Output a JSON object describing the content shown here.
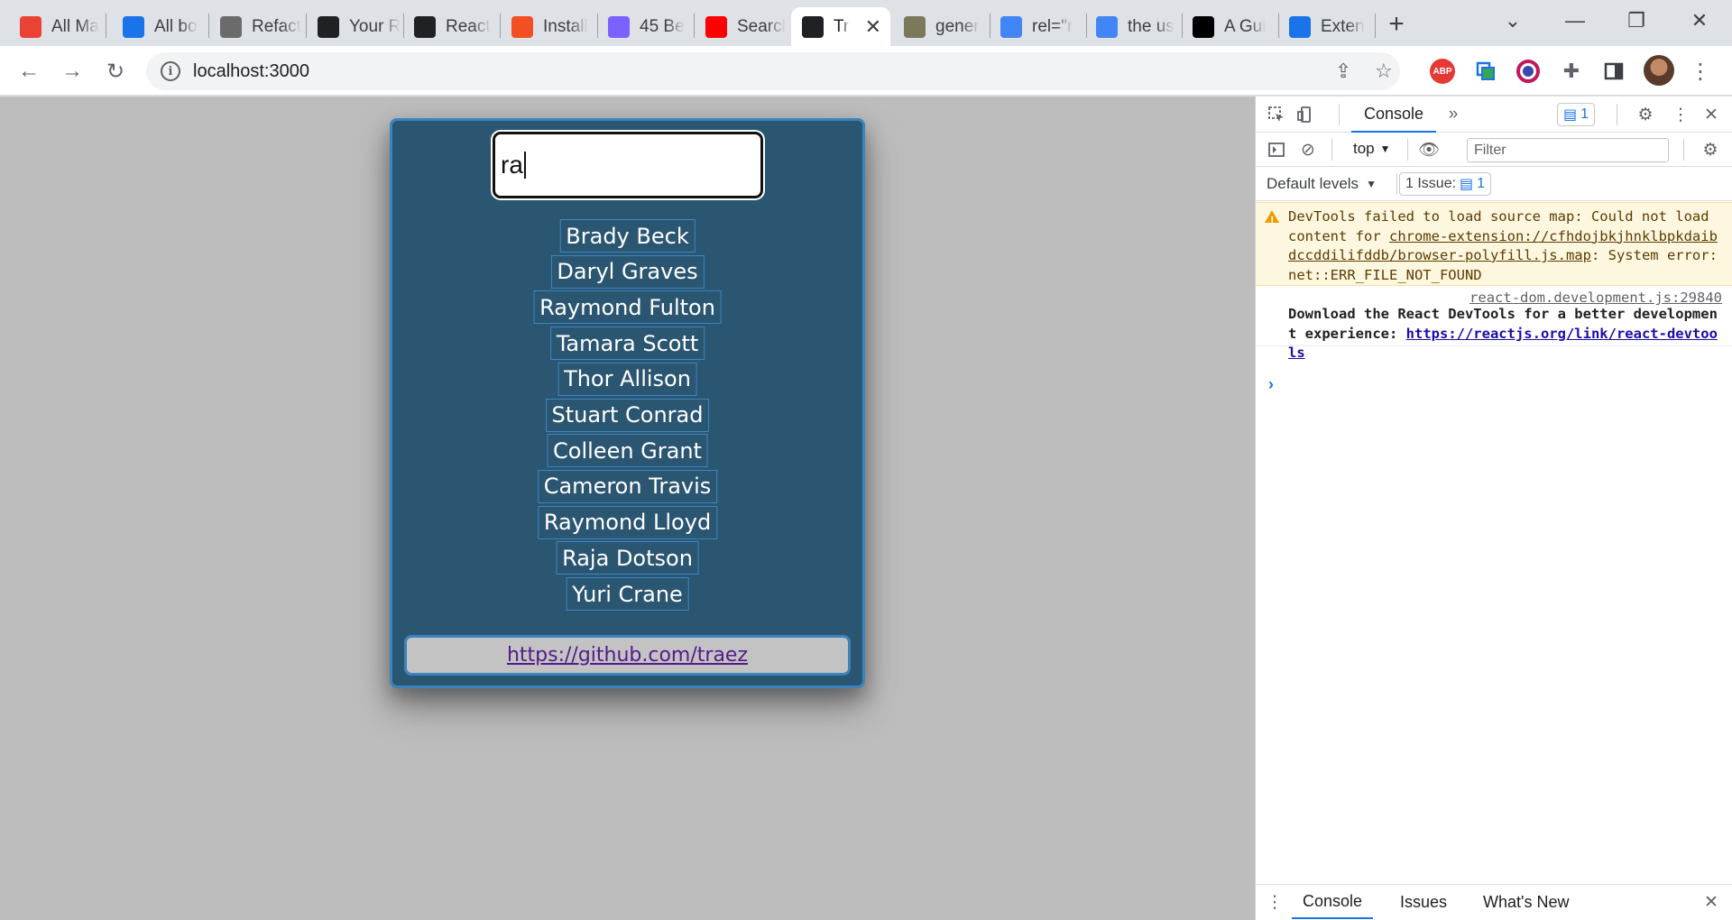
{
  "browser": {
    "tabs": [
      {
        "title": "All Ma",
        "icon": "gmail-icon",
        "color": "#ea4335"
      },
      {
        "title": "All bo",
        "icon": "cloud-icon",
        "color": "#1a73e8"
      },
      {
        "title": "Refact",
        "icon": "chatgpt-icon",
        "color": "#6b6b6b"
      },
      {
        "title": "Your R",
        "icon": "github-icon",
        "color": "#202124"
      },
      {
        "title": "React",
        "icon": "notion-icon",
        "color": "#202124"
      },
      {
        "title": "Install",
        "icon": "microsoft-icon",
        "color": "#f25022"
      },
      {
        "title": "45 Be",
        "icon": "c-letter-icon",
        "color": "#7b61ff"
      },
      {
        "title": "Searcl",
        "icon": "youtube-icon",
        "color": "#ff0000"
      },
      {
        "title": "Tr",
        "icon": "react-icon",
        "color": "#202124",
        "active": true
      },
      {
        "title": "gener",
        "icon": "pixel-pattern-icon",
        "color": "#7a7a5a"
      },
      {
        "title": "rel=\"r",
        "icon": "google-icon",
        "color": "#4285f4"
      },
      {
        "title": "the us",
        "icon": "google-icon",
        "color": "#4285f4"
      },
      {
        "title": "A Gui",
        "icon": "medium-icon",
        "color": "#000000"
      },
      {
        "title": "Exten",
        "icon": "puzzle-icon",
        "color": "#1a73e8"
      }
    ],
    "address": "localhost:3000"
  },
  "app": {
    "search_value": "ra",
    "names": [
      "Brady Beck",
      "Daryl Graves",
      "Raymond Fulton",
      "Tamara Scott",
      "Thor Allison",
      "Stuart Conrad",
      "Colleen Grant",
      "Cameron Travis",
      "Raymond Lloyd",
      "Raja Dotson",
      "Yuri Crane"
    ],
    "footer_link": "https://github.com/traez"
  },
  "devtools": {
    "tab_console": "Console",
    "issues_count_top": "1",
    "context": "top",
    "filter_placeholder": "Filter",
    "levels": "Default levels",
    "issues_label": "1 Issue:",
    "issues_count": "1",
    "warning_text": "DevTools failed to load source map: Could not load content for ",
    "warning_link": "chrome-extension://cfhdojbkjhnklbpkdaibdccddilifddb/browser-polyfill.js.map",
    "warning_tail": ": System error: net::ERR_FILE_NOT_FOUND",
    "info_source": "react-dom.development.js:29840",
    "info_text": "Download the React DevTools for a better development experience: ",
    "info_link": "https://reactjs.org/link/react-devtools",
    "drawer_tabs": [
      "Console",
      "Issues",
      "What's New"
    ]
  },
  "colors": {
    "card_bg": "#2b5671",
    "card_border": "#3c84bd",
    "page_bg": "#bdbdbd"
  }
}
